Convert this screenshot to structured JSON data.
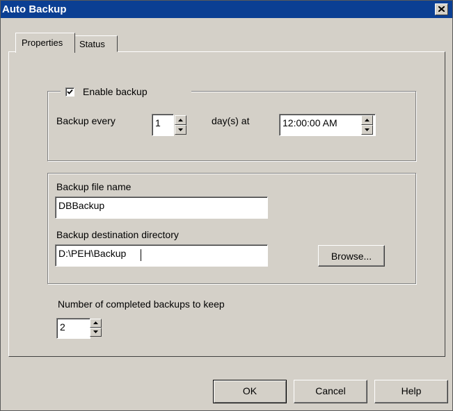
{
  "window": {
    "title": "Auto Backup"
  },
  "tabs": [
    {
      "label": "Properties",
      "active": true
    },
    {
      "label": "Status",
      "active": false
    }
  ],
  "schedule": {
    "enable_label": "Enable backup",
    "enabled": true,
    "every_label": "Backup every",
    "every_value": "1",
    "unit_label": "day(s) at",
    "time_value": "12:00:00 AM"
  },
  "file": {
    "name_label": "Backup file name",
    "name_value": "DBBackup",
    "dir_label": "Backup destination directory",
    "dir_value": "D:\\PEH\\Backup",
    "browse_label": "Browse..."
  },
  "keep": {
    "label": "Number of completed backups to keep",
    "value": "2"
  },
  "buttons": {
    "ok": "OK",
    "cancel": "Cancel",
    "help": "Help"
  }
}
